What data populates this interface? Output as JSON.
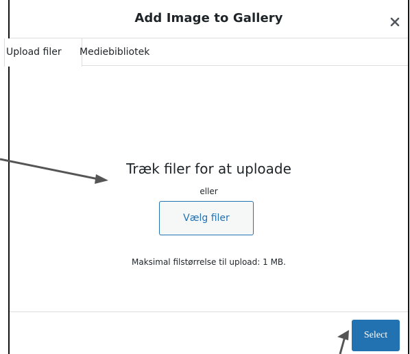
{
  "modal": {
    "title": "Add Image to Gallery",
    "close_icon": "close-icon"
  },
  "tabs": [
    {
      "label": "Upload filer",
      "active": true
    },
    {
      "label": "Mediebibliotek",
      "active": false
    }
  ],
  "upload": {
    "drop_title": "Træk filer for at uploade",
    "or_text": "eller",
    "select_files_label": "Vælg filer",
    "max_size_text": "Maksimal filstørrelse til upload: 1 MB."
  },
  "footer": {
    "select_label": "Select"
  },
  "colors": {
    "primary": "#2271b1",
    "border": "#dcdcde",
    "text": "#1d2327",
    "annotation_arrow": "#555555"
  }
}
